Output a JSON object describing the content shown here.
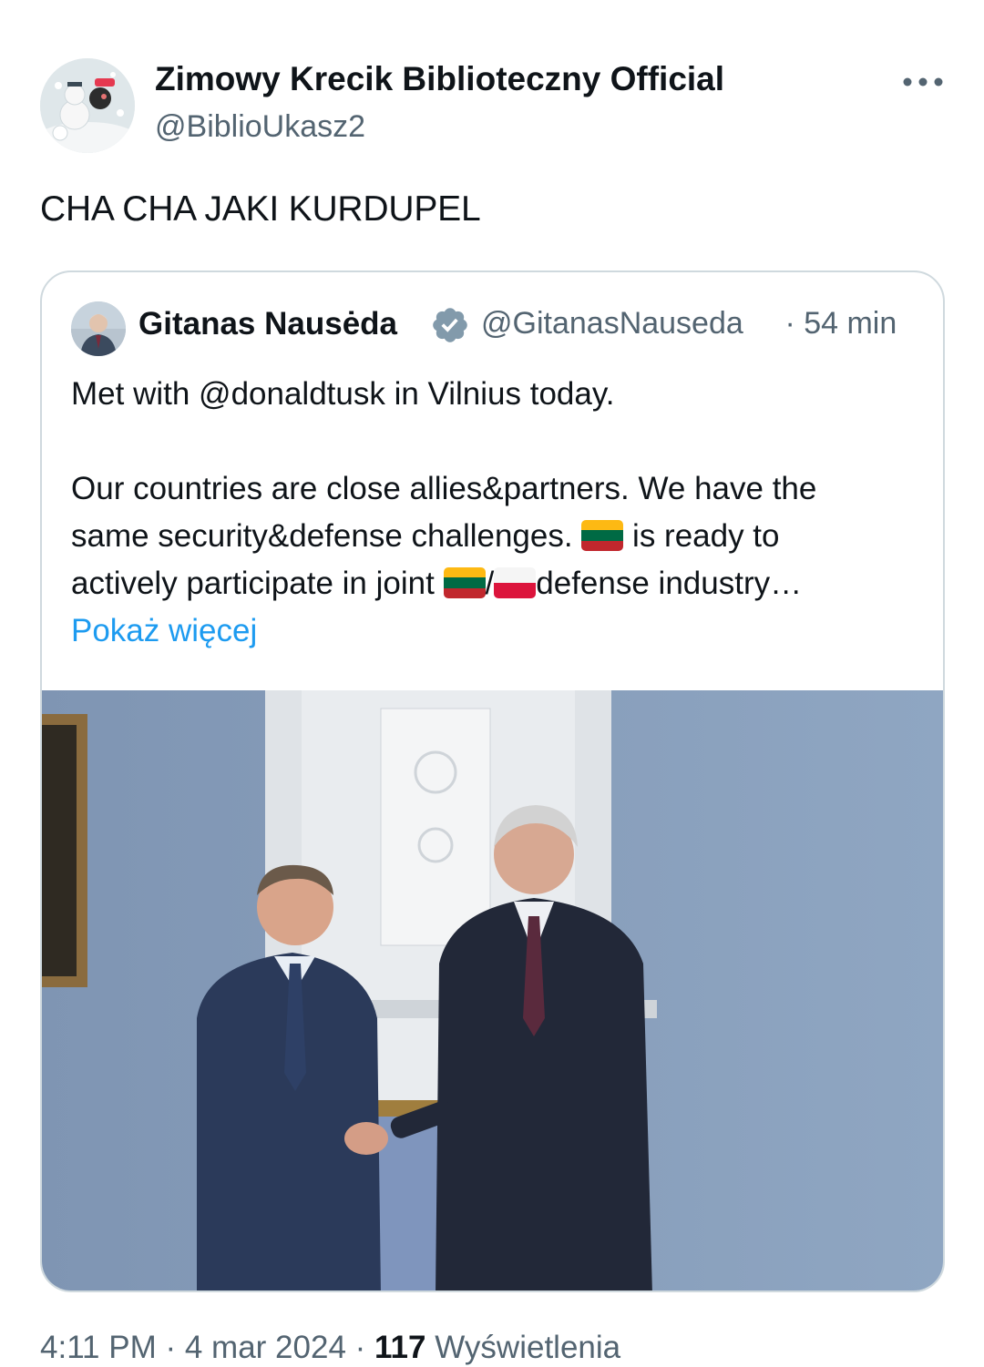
{
  "author": {
    "name": "Zimowy Krecik Biblioteczny Official",
    "handle": "@BiblioUkasz2",
    "avatar_icon": "snowman-mole-avatar"
  },
  "menu": {
    "more_icon": "more-horizontal-icon"
  },
  "tweet": {
    "text": "CHA CHA JAKI KURDUPEL"
  },
  "quote": {
    "name": "Gitanas Nausėda",
    "verified_icon": "verified-badge-icon",
    "handle": "@GitanasNauseda",
    "time": " · 54 min",
    "line1": "Met with @donaldtusk in Vilnius today.",
    "line2": "Our countries are close allies&partners. We have the",
    "line3a": "same security&defense challenges. ",
    "line3b": " is ready to",
    "line4a": "actively participate in joint ",
    "line4sep": "/",
    "line4b": "defense industry…",
    "show_more": "Pokaż więcej",
    "photo_icon": "handshake-photo"
  },
  "meta": {
    "time": "4:11 PM",
    "date": " · 4 mar 2024 · ",
    "views_count": "117",
    "views_label": " Wyświetlenia"
  },
  "colors": {
    "text": "#0f1419",
    "secondary": "#536471",
    "link": "#1d9bf0",
    "border": "#cfd9de",
    "verified": "#829aab"
  }
}
